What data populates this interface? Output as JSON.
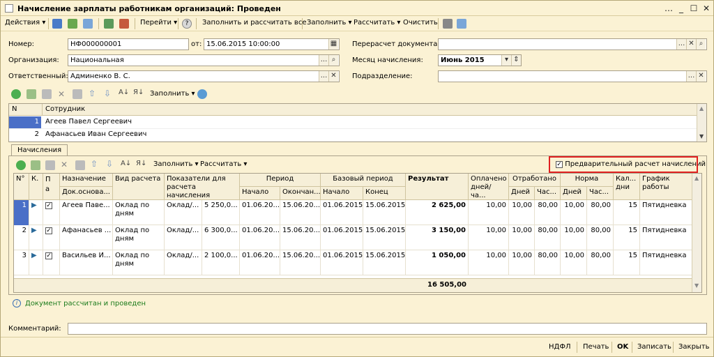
{
  "window": {
    "title": "Начисление зарплаты работникам организаций: Проведен"
  },
  "toolbar": {
    "actions": "Действия",
    "goto": "Перейти",
    "fill_calc_all": "Заполнить и рассчитать все",
    "fill": "Заполнить",
    "calculate": "Рассчитать",
    "clear": "Очистить"
  },
  "form": {
    "number_label": "Номер:",
    "number_value": "НФ000000001",
    "from_label": "от:",
    "date_value": "15.06.2015 10:00:00",
    "org_label": "Организация:",
    "org_value": "Национальная",
    "resp_label": "Ответственный:",
    "resp_value": "Админенко В. С.",
    "recalc_label": "Перерасчет документа:",
    "recalc_value": "",
    "month_label": "Месяц начисления:",
    "month_value": "Июнь 2015",
    "dept_label": "Подразделение:",
    "dept_value": ""
  },
  "employees_toolbar": {
    "fill": "Заполнить"
  },
  "employees_grid": {
    "headers": [
      "N",
      "Сотрудник"
    ],
    "rows": [
      {
        "n": "1",
        "name": "Агеев Павел Сергеевич"
      },
      {
        "n": "2",
        "name": "Афанасьев Иван Сергеевич"
      }
    ]
  },
  "tabs": {
    "accruals": "Начисления"
  },
  "accruals_toolbar": {
    "fill": "Заполнить",
    "calculate": "Рассчитать"
  },
  "preliminary": {
    "label": "Предварительный расчет начислений",
    "checked": true
  },
  "accruals_grid": {
    "headers": {
      "n": "N°",
      "k": "К.",
      "p": "П",
      "a": "а",
      "assignment": "Назначение",
      "doc_basis": "Док.основа...",
      "calc_type": "Вид расчета",
      "indicators": "Показатели для расчета начисления",
      "period": "Период",
      "period_start": "Начало",
      "period_end": "Окончан...",
      "base_period": "Базовый период",
      "base_start": "Начало",
      "base_end": "Конец",
      "result": "Результат",
      "paid_days": "Оплачено дней/ча...",
      "worked": "Отработано",
      "worked_days": "Дней",
      "worked_hours": "Час...",
      "norm": "Норма",
      "norm_days": "Дней",
      "norm_hours": "Час...",
      "cal_days": "Кал... дни",
      "schedule": "График работы"
    },
    "rows": [
      {
        "n": "1",
        "employee": "Агеев Паве...",
        "calc_type": "Оклад по дням",
        "ind_name": "Оклад/...",
        "ind_value": "5 250,0...",
        "p_start": "01.06.20...",
        "p_end": "15.06.20...",
        "b_start": "01.06.2015",
        "b_end": "15.06.2015",
        "result": "2 625,00",
        "paid": "10,00",
        "w_days": "10,00",
        "w_hours": "80,00",
        "n_days": "10,00",
        "n_hours": "80,00",
        "cal": "15",
        "schedule": "Пятидневка"
      },
      {
        "n": "2",
        "employee": "Афанасьев ...",
        "calc_type": "Оклад по дням",
        "ind_name": "Оклад/...",
        "ind_value": "6 300,0...",
        "p_start": "01.06.20...",
        "p_end": "15.06.20...",
        "b_start": "01.06.2015",
        "b_end": "15.06.2015",
        "result": "3 150,00",
        "paid": "10,00",
        "w_days": "10,00",
        "w_hours": "80,00",
        "n_days": "10,00",
        "n_hours": "80,00",
        "cal": "15",
        "schedule": "Пятидневка"
      },
      {
        "n": "3",
        "employee": "Васильев И...",
        "calc_type": "Оклад по дням",
        "ind_name": "Оклад/...",
        "ind_value": "2 100,0...",
        "p_start": "01.06.20...",
        "p_end": "15.06.20...",
        "b_start": "01.06.2015",
        "b_end": "15.06.2015",
        "result": "1 050,00",
        "paid": "10,00",
        "w_days": "10,00",
        "w_hours": "80,00",
        "n_days": "10,00",
        "n_hours": "80,00",
        "cal": "15",
        "schedule": "Пятидневка"
      }
    ],
    "total_result": "16 505,00"
  },
  "info": {
    "message": "Документ рассчитан и проведен"
  },
  "comment": {
    "label": "Комментарий:",
    "value": ""
  },
  "footer": {
    "ndfl": "НДФЛ",
    "print": "Печать",
    "ok": "OK",
    "save": "Записать",
    "close": "Закрыть"
  },
  "colors": {
    "background": "#fbf2d4",
    "highlight_border": "#e02020",
    "grid_header": "#f6efd8",
    "info_green": "#1a7a1a"
  }
}
